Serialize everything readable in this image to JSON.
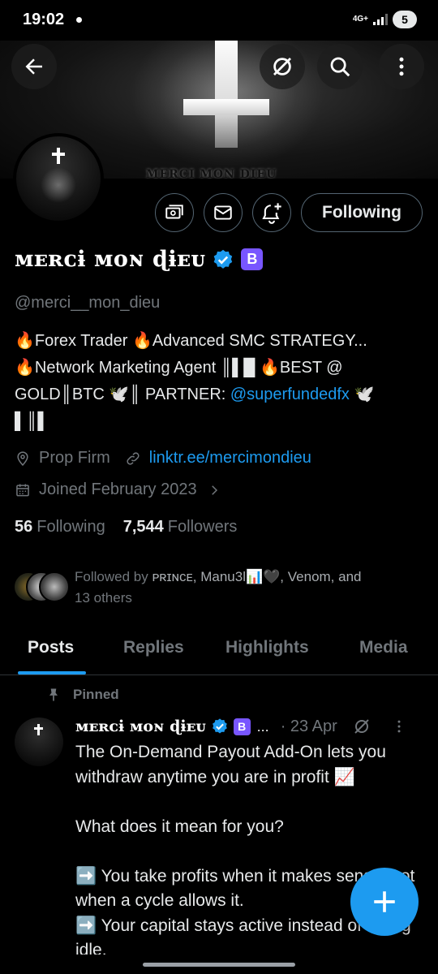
{
  "status_bar": {
    "time": "19:02",
    "network": "4G+",
    "battery": "5"
  },
  "banner": {
    "text": "MERCI MON DIEU"
  },
  "profile": {
    "display_name": "ᴍᴇʀᴄɨ ᴍᴏɴ ɖɨᴇᴜ",
    "subscription_badge": "B",
    "handle": "@merci__mon_dieu",
    "bio_line1": "🔥Forex Trader 🔥Advanced SMC STRATEGY...",
    "bio_line2": "🔥Network Marketing Agent ║▌█ 🔥BEST @",
    "bio_line3_prefix": "GOLD║BTC 🕊️║ PARTNER: ",
    "bio_link": "@superfundedfx",
    "bio_line3_suffix": " 🕊️",
    "bio_line4": "▌║▌",
    "location": "Prop Firm",
    "website": "linktr.ee/mercimondieu",
    "joined": "Joined February 2023",
    "following_count": "56",
    "following_label": "Following",
    "followers_count": "7,544",
    "followers_label": "Followers",
    "followed_by_prefix": "Followed by ",
    "followed_by_names": "ᴘʀɪɴᴄᴇ, Manu3l📊🖤, Venom, and",
    "followed_by_suffix": "13 others"
  },
  "actions": {
    "following_button": "Following"
  },
  "tabs": [
    {
      "label": "Posts",
      "active": true
    },
    {
      "label": "Replies",
      "active": false
    },
    {
      "label": "Highlights",
      "active": false
    },
    {
      "label": "Media",
      "active": false
    }
  ],
  "post": {
    "pinned_label": "Pinned",
    "author": "ᴍᴇʀᴄɨ ᴍᴏɴ ɖɨᴇᴜ",
    "badge": "B",
    "ellipsis": "...",
    "date": "· 23 Apr",
    "text": "The On-Demand Payout Add-On lets you withdraw anytime you are in profit 📈\n\nWhat does it mean for you?\n\n➡️ You take profits when it makes sense, not when a cycle allows it.\n➡️ Your capital stays active instead of sitting idle."
  },
  "colors": {
    "accent": "#1d9bf0",
    "muted": "#71767b",
    "badge": "#7856ff",
    "background": "#000000"
  },
  "icons": [
    "back-arrow-icon",
    "grok-icon",
    "search-icon",
    "more-vertical-icon",
    "tips-icon",
    "message-icon",
    "notification-bell-icon",
    "location-icon",
    "link-icon",
    "calendar-icon",
    "chevron-right-icon",
    "pin-icon",
    "verified-icon",
    "compose-plus-icon"
  ]
}
